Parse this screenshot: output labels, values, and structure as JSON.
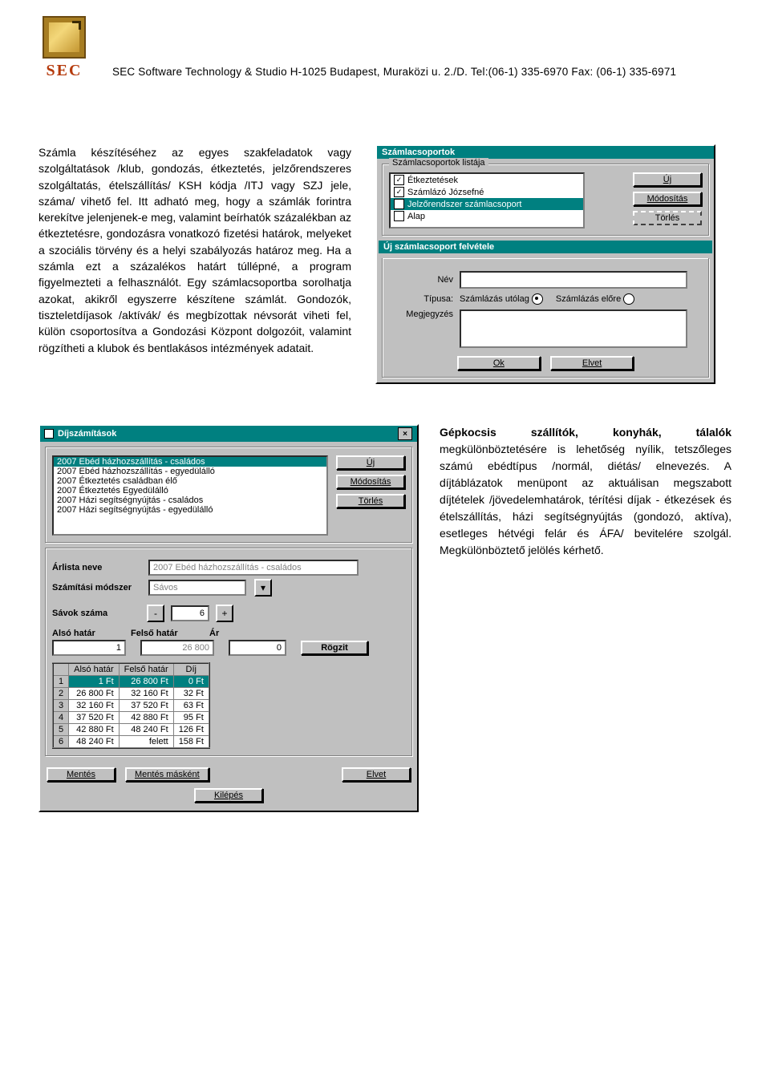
{
  "header": {
    "logo_text": "SEC",
    "line": "SEC Software Technology & Studio  H-1025 Budapest, Muraközi u. 2./D.  Tel:(06-1) 335-6970 Fax: (06-1) 335-6971"
  },
  "paragraph1": "Számla készítéséhez az egyes szakfeladatok vagy szolgáltatások /klub, gondozás, étkeztetés, jelzőrendszeres szolgáltatás, ételszállítás/ KSH kódja /ITJ vagy SZJ jele, száma/ vihető fel. Itt adható meg, hogy a számlák forintra kerekítve jelenjenek-e meg, valamint beírhatók százalékban az étkeztetésre, gondozásra vonatkozó fizetési határok, melyeket a szociális törvény és a helyi szabályozás határoz meg. Ha a számla ezt a százalékos határt túllépné, a program figyelmezteti a felhasználót. Egy számlacsoportba sorolhatja azokat, akikről egyszerre készítene számlát. Gondozók, tiszteletdíjasok /aktívák/ és megbízottak névsorát viheti fel, külön csoportosítva a Gondozási Központ dolgozóit, valamint rögzítheti a klubok és bentlakásos intézmények adatait.",
  "win_szamlacsop": {
    "title": "Számlacsoportok",
    "group_list_label": "Számlacsoportok listája",
    "items": [
      {
        "checked": true,
        "label": "Étkeztetések"
      },
      {
        "checked": true,
        "label": "Számlázó Józsefné"
      },
      {
        "checked": true,
        "label": "Jelzőrendszer számlacsoport",
        "selected": true
      },
      {
        "checked": false,
        "label": "Alap"
      }
    ],
    "btn_new": "Új",
    "btn_mod": "Módosítás",
    "btn_del": "Törlés",
    "group_new_label": "Új számlacsoport felvétele",
    "lbl_nev": "Név",
    "lbl_tipus": "Típusa:",
    "radio1": "Számlázás utólag",
    "radio2": "Számlázás előre",
    "lbl_megj": "Megjegyzés",
    "btn_ok": "Ok",
    "btn_cancel": "Elvet"
  },
  "win_dijszam": {
    "title": "Díjszámítások",
    "list": [
      {
        "label": "2007 Ebéd házhozszállítás - családos",
        "selected": true
      },
      {
        "label": "2007 Ebéd házhozszállítás - egyedülálló"
      },
      {
        "label": "2007 Étkeztetés családban élő"
      },
      {
        "label": "2007 Étkeztetés Egyedülálló"
      },
      {
        "label": "2007 Házi segítségnyújtás - családos"
      },
      {
        "label": "2007 Házi segítségnyújtás - egyedülálló"
      }
    ],
    "btn_new": "Új",
    "btn_mod": "Módosítás",
    "btn_del": "Törlés",
    "lbl_arlista": "Árlista neve",
    "val_arlista": "2007 Ebéd házhozszállítás - családos",
    "lbl_szmod": "Számítási módszer",
    "val_szmod": "Sávos",
    "lbl_savok": "Sávok száma",
    "val_savok": "6",
    "lbl_also": "Alsó határ",
    "lbl_felso": "Felső határ",
    "lbl_ar": "Ár",
    "val_also": "1",
    "val_felso": "26 800",
    "val_ar": "0",
    "btn_rogzit": "Rögzit",
    "grid_headers": [
      "",
      "Alsó határ",
      "Felső határ",
      "Díj"
    ],
    "grid_rows": [
      {
        "n": "1",
        "a": "1 Ft",
        "b": "26 800 Ft",
        "c": "0 Ft",
        "sel": true
      },
      {
        "n": "2",
        "a": "26 800 Ft",
        "b": "32 160 Ft",
        "c": "32 Ft"
      },
      {
        "n": "3",
        "a": "32 160 Ft",
        "b": "37 520 Ft",
        "c": "63 Ft"
      },
      {
        "n": "4",
        "a": "37 520 Ft",
        "b": "42 880 Ft",
        "c": "95 Ft"
      },
      {
        "n": "5",
        "a": "42 880 Ft",
        "b": "48 240 Ft",
        "c": "126 Ft"
      },
      {
        "n": "6",
        "a": "48 240 Ft",
        "b": "felett",
        "c": "158 Ft"
      }
    ],
    "btn_save": "Mentés",
    "btn_saveas": "Mentés másként",
    "btn_elvet": "Elvet",
    "btn_exit": "Kilépés"
  },
  "paragraph2_lead": "Gépkocsis szállítók, konyhák, tálalók",
  "paragraph2_rest": " megkülönböztetésére is lehetőség nyílik, tetszőleges számú ebédtípus /normál, diétás/ elnevezés. A díjtáblázatok menüpont az aktuálisan megszabott díjtételek /jövedelemhatárok, térítési díjak - étkezések és ételszállítás, házi segítségnyújtás (gondozó, aktíva), esetleges hétvégi felár és ÁFA/ bevitelére szolgál. Megkülönböztető jelölés kérhető."
}
